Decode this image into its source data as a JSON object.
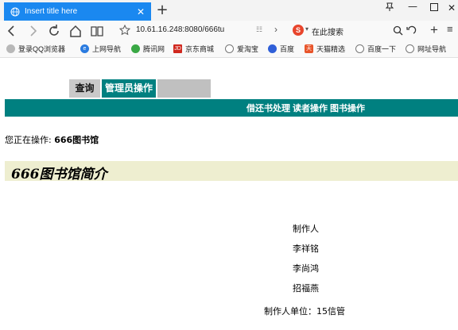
{
  "browser": {
    "tab_title": "Insert title here",
    "new_tab": "+",
    "address": "10.61.16.248:8080/666tu",
    "search_engine_label": "在此搜索",
    "bookmarks": [
      {
        "label": "登录QQ浏览器",
        "icon": "qq-icon"
      },
      {
        "label": "上网导航",
        "icon": "ie-icon"
      },
      {
        "label": "腾讯网",
        "icon": "tencent-icon"
      },
      {
        "label": "京东商城",
        "icon": "jd-icon"
      },
      {
        "label": "爱淘宝",
        "icon": "globe-icon"
      },
      {
        "label": "百度",
        "icon": "baidu-icon"
      },
      {
        "label": "天猫精选",
        "icon": "tmall-icon"
      },
      {
        "label": "百度一下",
        "icon": "globe-icon"
      },
      {
        "label": "网址导航",
        "icon": "globe-icon"
      }
    ]
  },
  "menu": {
    "tabs": [
      "查询",
      "管理员操作",
      ""
    ],
    "sub_links": [
      "借还书处理",
      "读者操作",
      "图书操作"
    ]
  },
  "status": {
    "prefix": "您正在操作:",
    "library": "666图书馆"
  },
  "intro": {
    "title": "666图书馆简介"
  },
  "credits": {
    "heading": "制作人",
    "members": [
      "李祥铭",
      "李尚鸿",
      "招福燕"
    ],
    "unit": "制作人单位：15信管"
  },
  "colors": {
    "tab_active": "#1a88f0",
    "menu_teal": "#008080",
    "intro_bg": "#eeeed0"
  }
}
